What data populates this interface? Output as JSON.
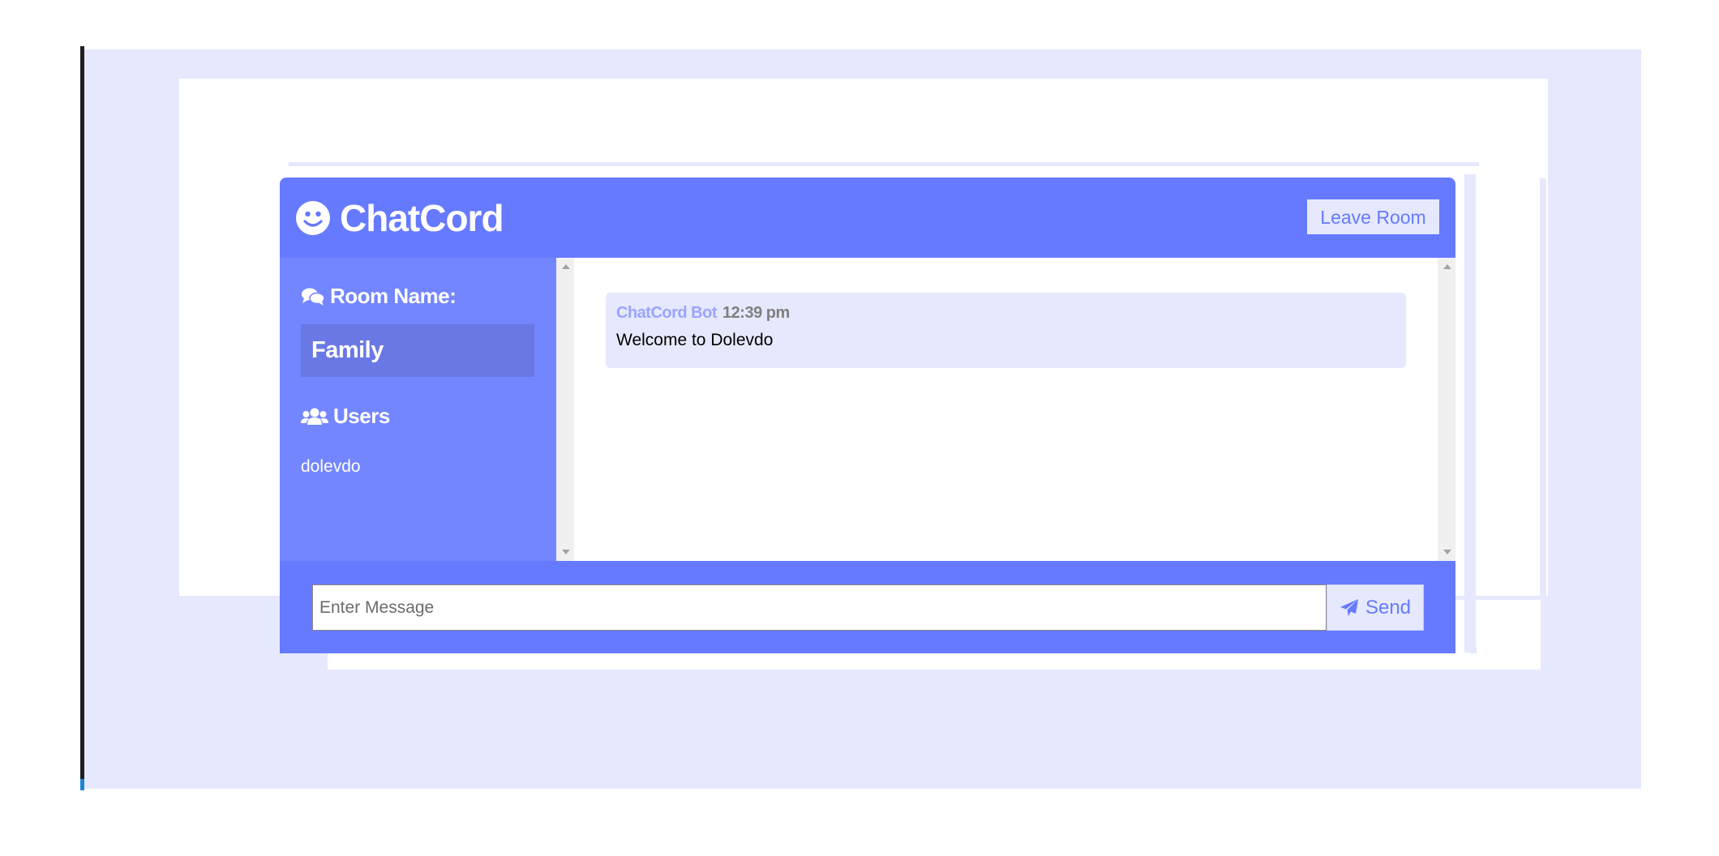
{
  "header": {
    "logo_icon": "smile-icon",
    "title": "ChatCord",
    "leave_button": "Leave Room"
  },
  "sidebar": {
    "room_heading_icon": "comments-icon",
    "room_heading": "Room Name:",
    "room_name": "Family",
    "users_heading_icon": "users-icon",
    "users_heading": "Users",
    "users": [
      "dolevdo"
    ]
  },
  "messages": [
    {
      "author": "ChatCord Bot",
      "time": "12:39 pm",
      "text": "Welcome to Dolevdo"
    }
  ],
  "form": {
    "placeholder": "Enter Message",
    "send_icon": "paper-plane-icon",
    "send_label": "Send"
  },
  "colors": {
    "primary": "#667aff",
    "sidebar": "#7386ff",
    "light": "#e6e9fd",
    "room_box": "#6a78e6",
    "author": "#9aa4ff"
  }
}
